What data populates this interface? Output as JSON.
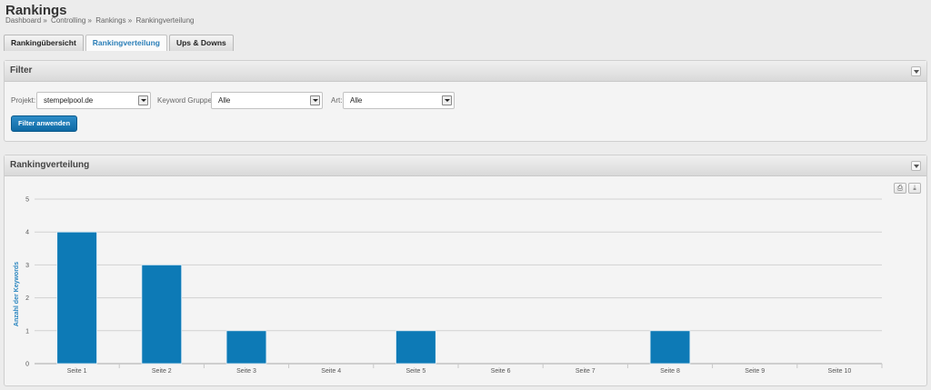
{
  "header": {
    "title": "Rankings",
    "breadcrumb": [
      "Dashboard »",
      "Controlling »",
      "Rankings »",
      "Rankingverteilung"
    ]
  },
  "tabs": [
    {
      "label": "Rankingübersicht",
      "active": false
    },
    {
      "label": "Rankingverteilung",
      "active": true
    },
    {
      "label": "Ups & Downs",
      "active": false
    }
  ],
  "filter": {
    "title": "Filter",
    "projekt_label": "Projekt:",
    "projekt_value": "stempelpool.de",
    "gruppe_label": "Keyword Gruppe:",
    "gruppe_value": "Alle",
    "art_label": "Art:",
    "art_value": "Alle",
    "apply_label": "Filter anwenden"
  },
  "chart_panel": {
    "title": "Rankingverteilung",
    "tools": [
      "print-icon",
      "download-icon"
    ]
  },
  "colors": {
    "bar": "#0d7ab6",
    "accent": "#2b86c0"
  },
  "chart_data": {
    "type": "bar",
    "categories": [
      "Seite 1",
      "Seite 2",
      "Seite 3",
      "Seite 4",
      "Seite 5",
      "Seite 6",
      "Seite 7",
      "Seite 8",
      "Seite 9",
      "Seite 10"
    ],
    "values": [
      4,
      3,
      1,
      0,
      1,
      0,
      0,
      1,
      0,
      0
    ],
    "ylabel": "Anzahl der Keywords",
    "ylim": [
      0,
      5
    ],
    "yticks": [
      0,
      1,
      2,
      3,
      4,
      5
    ],
    "grid": true
  }
}
